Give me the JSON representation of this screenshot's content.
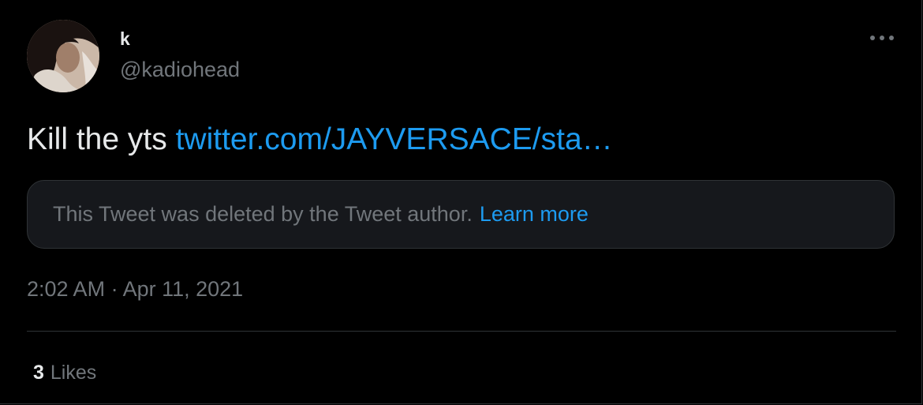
{
  "user": {
    "display_name": "k",
    "handle": "@kadiohead"
  },
  "tweet": {
    "text": "Kill the yts",
    "link": "twitter.com/JAYVERSACE/sta…"
  },
  "quoted_tweet": {
    "deleted_message": "This Tweet was deleted by the Tweet author.",
    "learn_more_label": "Learn more"
  },
  "timestamp": "2:02 AM · Apr 11, 2021",
  "stats": {
    "likes_count": "3",
    "likes_label": "Likes"
  },
  "icons": {
    "more": "more-horizontal-icon"
  },
  "colors": {
    "background": "#000000",
    "text_primary": "#e7e9ea",
    "text_secondary": "#71767b",
    "link": "#1d9bf0",
    "card_background": "#16181c",
    "border": "#2f3336"
  }
}
